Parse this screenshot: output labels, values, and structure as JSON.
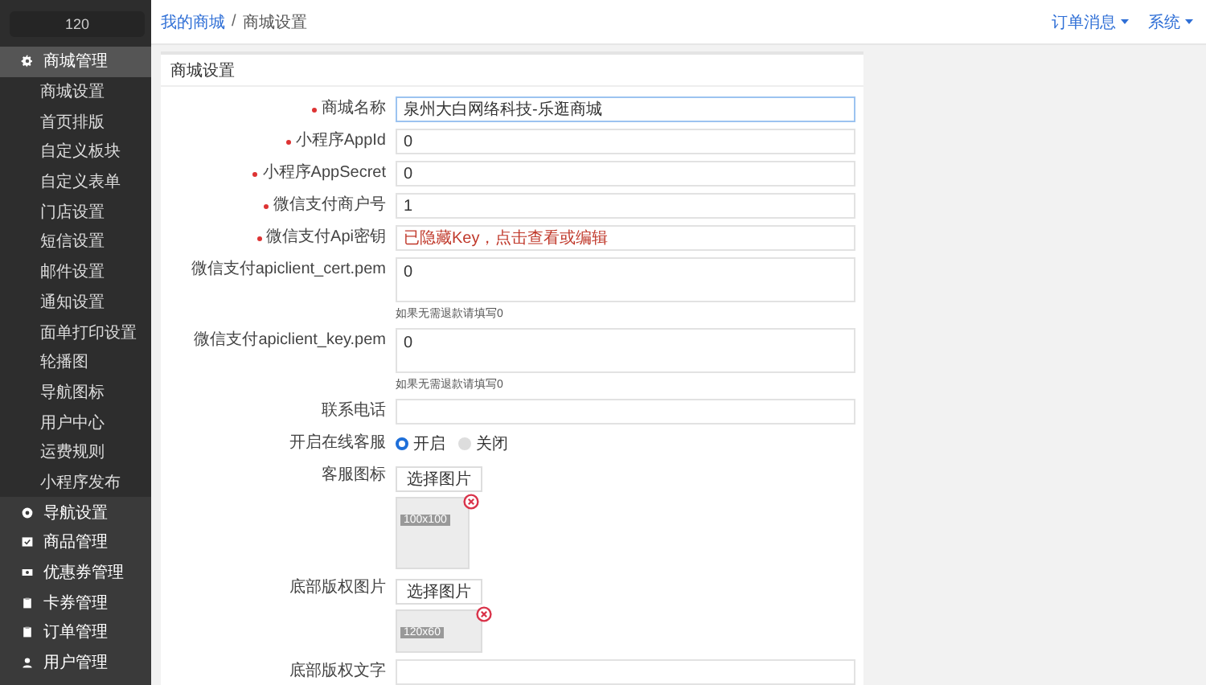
{
  "sidebar": {
    "search_value": "120",
    "items": [
      {
        "label": "商城管理",
        "selected": true,
        "expanded": true,
        "children": [
          {
            "label": "商城设置"
          },
          {
            "label": "首页排版"
          },
          {
            "label": "自定义板块"
          },
          {
            "label": "自定义表单"
          },
          {
            "label": "门店设置"
          },
          {
            "label": "短信设置"
          },
          {
            "label": "邮件设置"
          },
          {
            "label": "通知设置"
          },
          {
            "label": "面单打印设置"
          },
          {
            "label": "轮播图"
          },
          {
            "label": "导航图标"
          },
          {
            "label": "用户中心"
          },
          {
            "label": "运费规则"
          },
          {
            "label": "小程序发布"
          }
        ]
      },
      {
        "label": "导航设置",
        "selected": false,
        "expanded": false
      },
      {
        "label": "商品管理",
        "selected": false,
        "expanded": false
      },
      {
        "label": "优惠券管理",
        "selected": false,
        "expanded": false
      },
      {
        "label": "卡券管理",
        "selected": false,
        "expanded": false
      },
      {
        "label": "订单管理",
        "selected": false,
        "expanded": false
      },
      {
        "label": "用户管理",
        "selected": false,
        "expanded": false
      }
    ]
  },
  "header": {
    "breadcrumb": [
      "我的商城",
      "商城设置"
    ],
    "separator": "/",
    "menus": [
      "订单消息",
      "系统"
    ]
  },
  "panel": {
    "title": "商城设置",
    "fields": [
      {
        "kind": "input",
        "label": "商城名称",
        "required": true,
        "focused": true,
        "value": "泉州大白网络科技-乐逛商城"
      },
      {
        "kind": "input",
        "label": "小程序AppId",
        "required": true,
        "focused": false,
        "value": "0"
      },
      {
        "kind": "input",
        "label": "小程序AppSecret",
        "required": true,
        "focused": false,
        "value": "0"
      },
      {
        "kind": "input",
        "label": "微信支付商户号",
        "required": true,
        "focused": false,
        "value": "1"
      },
      {
        "kind": "secret",
        "label": "微信支付Api密钥",
        "required": true,
        "value": "已隐藏Key，点击查看或编辑"
      },
      {
        "kind": "textarea",
        "label": "微信支付apiclient_cert.pem",
        "required": false,
        "value": "0",
        "help": "如果无需退款请填写0"
      },
      {
        "kind": "textarea",
        "label": "微信支付apiclient_key.pem",
        "required": false,
        "value": "0",
        "help": "如果无需退款请填写0"
      },
      {
        "kind": "input",
        "label": "联系电话",
        "required": false,
        "focused": false
      },
      {
        "kind": "radio",
        "label": "开启在线客服",
        "required": false,
        "options": [
          {
            "label": "开启",
            "selected": true
          },
          {
            "label": "关闭",
            "selected": false
          }
        ]
      },
      {
        "kind": "square_image",
        "label": "客服图标",
        "required": false,
        "button": "选择图片",
        "size": "100x100"
      },
      {
        "kind": "wide_image",
        "label": "底部版权图片",
        "required": false,
        "button": "选择图片",
        "size": "120x60"
      },
      {
        "kind": "input",
        "label": "底部版权文字",
        "required": false,
        "focused": false
      }
    ]
  }
}
